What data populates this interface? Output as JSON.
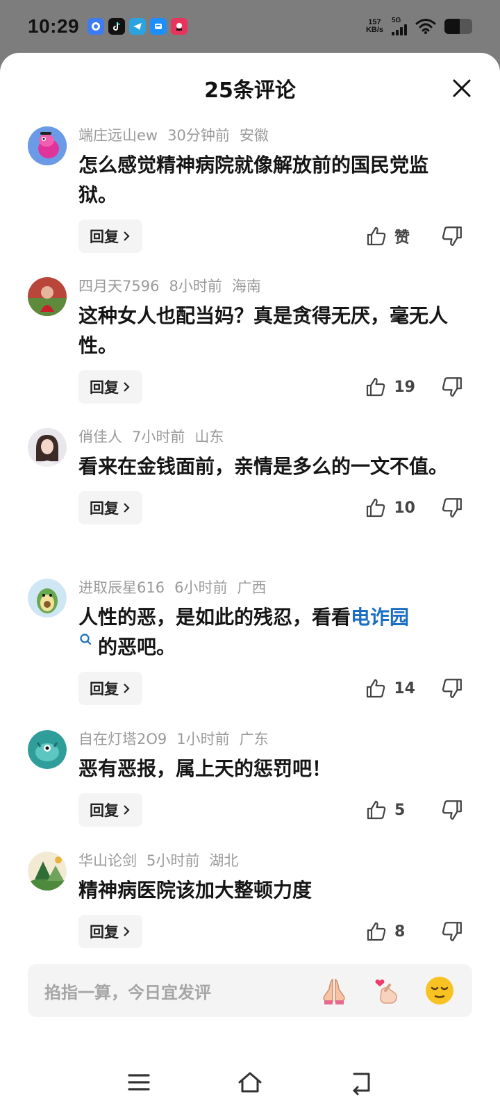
{
  "status_bar": {
    "time": "10:29",
    "net_speed_value": "157",
    "net_speed_unit": "KB/s",
    "network_type": "5G",
    "battery_level": 0.55
  },
  "header": {
    "title": "25条评论"
  },
  "comments": [
    {
      "username": "端庄远山ew",
      "time_ago": "30分钟前",
      "location": "安徽",
      "text": "怎么感觉精神病院就像解放前的国民党监狱。",
      "reply_label": "回复",
      "like_label": "赞"
    },
    {
      "username": "四月天7596",
      "time_ago": "8小时前",
      "location": "海南",
      "text": "这种女人也配当妈？真是贪得无厌，毫无人性。",
      "reply_label": "回复",
      "like_label": "19"
    },
    {
      "username": "俏佳人",
      "time_ago": "7小时前",
      "location": "山东",
      "text": "看来在金钱面前，亲情是多么的一文不值。",
      "reply_label": "回复",
      "like_label": "10"
    },
    {
      "username": "进取辰星616",
      "time_ago": "6小时前",
      "location": "广西",
      "text_before": "人性的恶，是如此的残忍，看看",
      "link_text": "电诈园",
      "text_after": "的恶吧。",
      "reply_label": "回复",
      "like_label": "14"
    },
    {
      "username": "自在灯塔2O9",
      "time_ago": "1小时前",
      "location": "广东",
      "text": "恶有恶报，属上天的惩罚吧！",
      "reply_label": "回复",
      "like_label": "5"
    },
    {
      "username": "华山论剑",
      "time_ago": "5小时前",
      "location": "湖北",
      "text": "精神病医院该加大整顿力度",
      "reply_label": "回复",
      "like_label": "8"
    }
  ],
  "input": {
    "placeholder": "掐指一算，今日宜发评",
    "emojis": [
      "🙏",
      "🫰",
      "😌"
    ]
  },
  "nav": [
    "menu-icon",
    "home-icon",
    "back-icon"
  ]
}
